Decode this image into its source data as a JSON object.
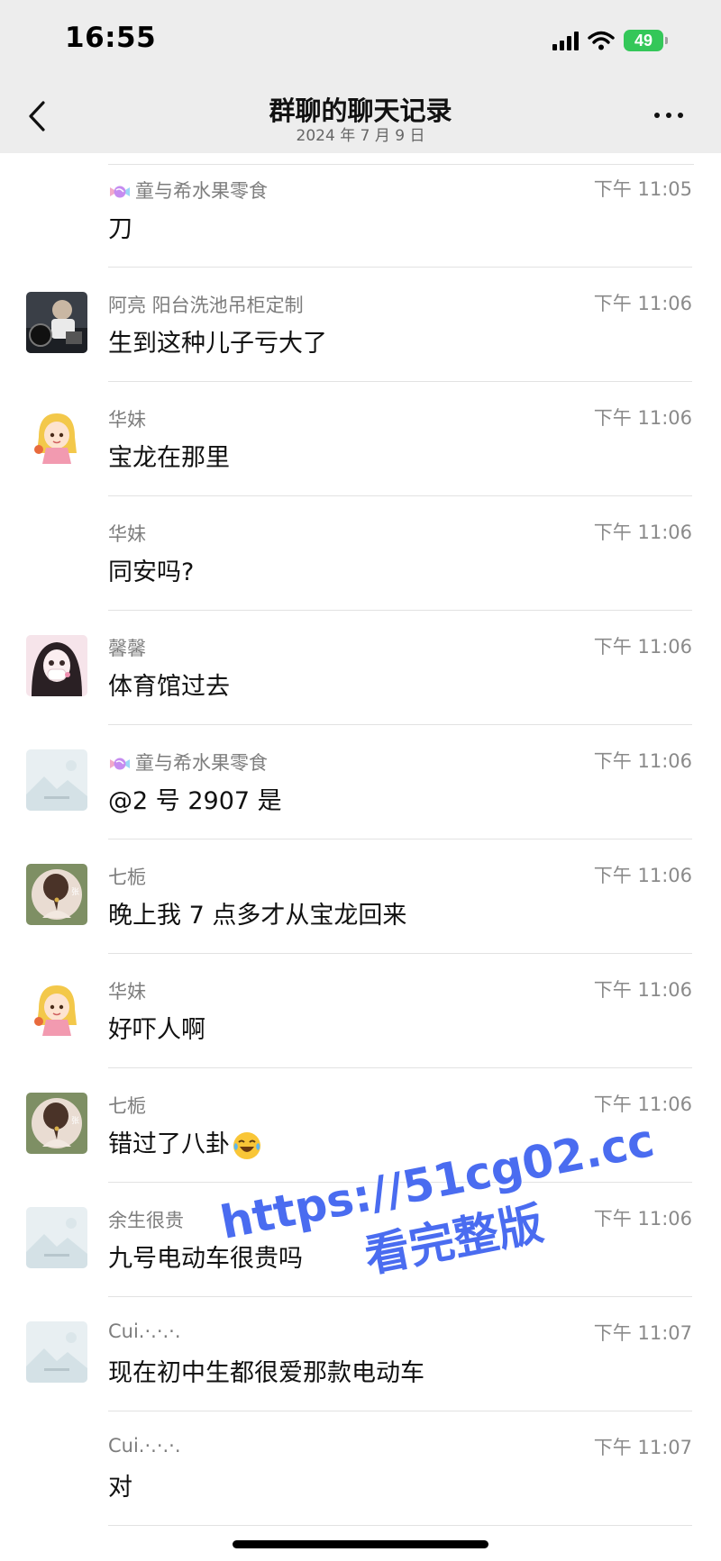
{
  "status_bar": {
    "time": "16:55",
    "battery": "49"
  },
  "header": {
    "title": "群聊的聊天记录",
    "date": "2024 年 7 月 9 日"
  },
  "messages": [
    {
      "sender": "童与希水果零食",
      "time": "下午 11:05",
      "text": "刀",
      "avatar": "none",
      "candy": true
    },
    {
      "sender": "阿亮 阳台洗池吊柜定制",
      "time": "下午 11:06",
      "text": "生到这种儿子亏大了",
      "avatar": "photo-dark"
    },
    {
      "sender": "华妹",
      "time": "下午 11:06",
      "text": "宝龙在那里",
      "avatar": "cartoon-girl"
    },
    {
      "sender": "华妹",
      "time": "下午 11:06",
      "text": "同安吗?",
      "avatar": "none"
    },
    {
      "sender": "馨馨",
      "time": "下午 11:06",
      "text": "体育馆过去",
      "avatar": "girl-portrait"
    },
    {
      "sender": "童与希水果零食",
      "time": "下午 11:06",
      "text": "@2 号 2907 是",
      "avatar": "placeholder",
      "candy": true
    },
    {
      "sender": "七栀",
      "time": "下午 11:06",
      "text": "晚上我 7 点多才从宝龙回来",
      "avatar": "green-back"
    },
    {
      "sender": "华妹",
      "time": "下午 11:06",
      "text": "好吓人啊",
      "avatar": "cartoon-girl"
    },
    {
      "sender": "七栀",
      "time": "下午 11:06",
      "text": "错过了八卦",
      "avatar": "green-back",
      "emoji": "laughing-crying"
    },
    {
      "sender": "余生很贵",
      "time": "下午 11:06",
      "text": "九号电动车很贵吗",
      "avatar": "placeholder"
    },
    {
      "sender": "Cui.·.·.·.",
      "time": "下午 11:07",
      "text": "现在初中生都很爱那款电动车",
      "avatar": "placeholder"
    },
    {
      "sender": "Cui.·.·.·.",
      "time": "下午 11:07",
      "text": "对",
      "avatar": "none"
    }
  ],
  "watermark": {
    "line1": "https://51cg02.cc",
    "line2": "看完整版"
  },
  "colors": {
    "header_bg": "#ededed",
    "battery": "#34c759",
    "watermark": "#4a6cf0"
  }
}
